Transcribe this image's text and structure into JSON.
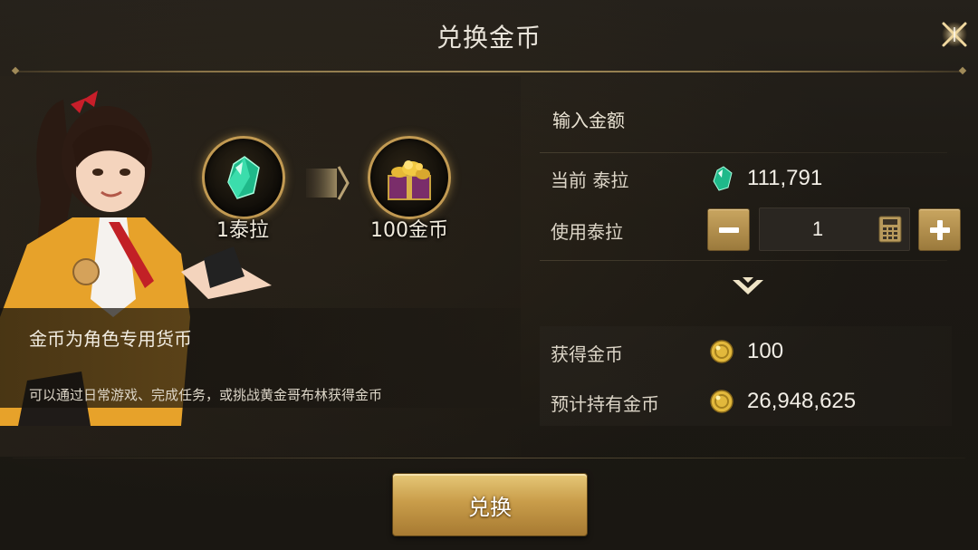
{
  "header": {
    "title": "兑换金币",
    "close_icon": "close-x-icon"
  },
  "exchange": {
    "from_item": {
      "label": "1泰拉",
      "icon": "tera-gem-icon"
    },
    "to_item": {
      "label": "100金币",
      "icon": "gold-chest-icon"
    }
  },
  "info": {
    "title": "金币为角色专用货币",
    "description": "可以通过日常游戏、完成任务，或挑战黄金哥布林获得金币"
  },
  "form": {
    "section_title": "输入金额",
    "current_label": "当前 泰拉",
    "current_value": "111,791",
    "use_label": "使用泰拉",
    "quantity": "1",
    "minus_icon": "minus-icon",
    "plus_icon": "plus-icon",
    "calculator_icon": "calculator-icon",
    "gain_label": "获得金币",
    "gain_value": "100",
    "expected_label": "预计持有金币",
    "expected_value": "26,948,625"
  },
  "footer": {
    "confirm_label": "兑换"
  },
  "colors": {
    "gold": "#c99d4a",
    "gem": "#2fd6a0",
    "coin": "#e2b83c"
  }
}
